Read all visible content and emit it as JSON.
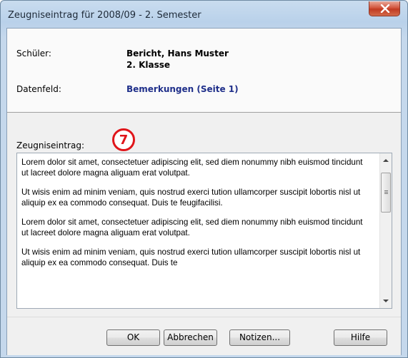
{
  "window": {
    "title": "Zeugniseintrag für 2008/09 - 2. Semester"
  },
  "header": {
    "student_label": "Schüler:",
    "student_name": "Bericht, Hans Muster",
    "student_class": "2. Klasse",
    "datafield_label": "Datenfeld:",
    "datafield_value": "Bemerkungen (Seite 1)"
  },
  "entry": {
    "label": "Zeugniseintrag:",
    "badge": "7",
    "paragraphs": [
      "Lorem dolor sit amet, consectetuer adipiscing elit, sed diem nonummy nibh euismod tincidunt ut lacreet dolore magna aliguam erat volutpat.",
      "Ut wisis enim ad minim veniam, quis nostrud exerci tution ullamcorper suscipit lobortis nisl ut aliquip ex ea commodo consequat. Duis te feugifacilisi.",
      "Lorem dolor sit amet, consectetuer adipiscing elit, sed diem nonummy nibh euismod tincidunt ut lacreet dolore magna aliguam erat volutpat.",
      "Ut wisis enim ad minim veniam, quis nostrud exerci tution ullamcorper suscipit lobortis nisl ut aliquip ex ea commodo consequat. Duis te"
    ]
  },
  "buttons": {
    "ok": "OK",
    "abbrechen": "Abbrechen",
    "notizen": "Notizen...",
    "hilfe": "Hilfe"
  },
  "icons": {
    "close": "close-icon"
  },
  "colors": {
    "badge": "#e0151a",
    "datafield": "#1f2f8a",
    "close_button": "#c13b22"
  }
}
